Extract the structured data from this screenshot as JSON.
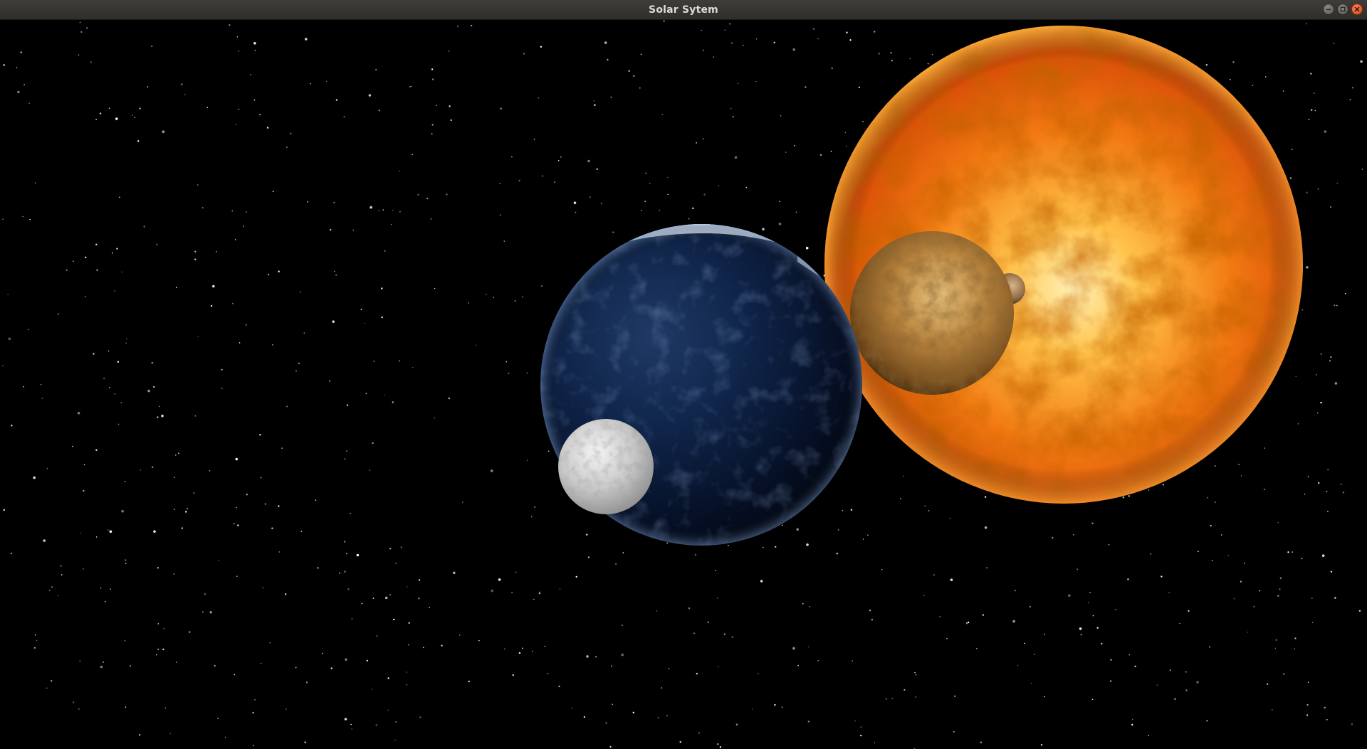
{
  "window": {
    "title": "Solar Sytem",
    "controls": {
      "minimize_icon": "minimize-icon",
      "maximize_icon": "maximize-icon",
      "close_icon": "close-icon"
    }
  },
  "scene": {
    "background_color": "#000000",
    "bodies": [
      {
        "name": "sun",
        "colors": [
          "#ffe9a8",
          "#ffa830",
          "#f07010",
          "#c23a05"
        ]
      },
      {
        "name": "venus",
        "colors": [
          "#f2cf8a",
          "#c99348",
          "#8a5a22",
          "#4a2e10"
        ]
      },
      {
        "name": "mercury",
        "colors": [
          "#d9b890",
          "#9a7550",
          "#5a4028"
        ]
      },
      {
        "name": "earth",
        "colors": [
          "#20365c",
          "#0b1a33",
          "#040a18",
          "#ffffff",
          "#4e7a3a",
          "#b07848"
        ]
      },
      {
        "name": "moon",
        "colors": [
          "#f2f2f2",
          "#c8c8c8",
          "#8a8a8a"
        ]
      }
    ]
  }
}
